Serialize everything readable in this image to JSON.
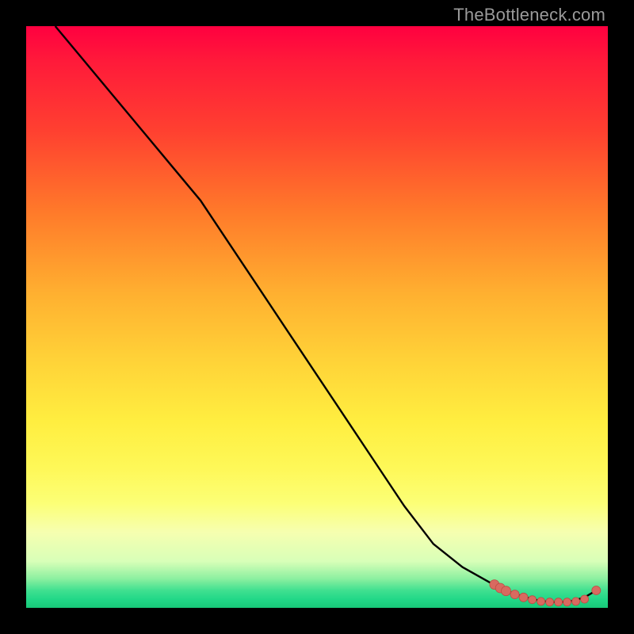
{
  "watermark": "TheBottleneck.com",
  "colors": {
    "page_bg": "#000000",
    "line": "#000000",
    "marker_fill": "#d86a60",
    "marker_stroke": "#c04a42",
    "gradient_top": "#ff0040",
    "gradient_bottom": "#18c878"
  },
  "chart_data": {
    "type": "line",
    "title": "",
    "xlabel": "",
    "ylabel": "",
    "xlim": [
      0,
      100
    ],
    "ylim": [
      0,
      100
    ],
    "grid": false,
    "legend": false,
    "series": [
      {
        "name": "curve",
        "x": [
          5,
          10,
          15,
          20,
          25,
          30,
          35,
          40,
          45,
          50,
          55,
          60,
          65,
          70,
          75,
          80,
          82,
          84,
          86,
          88,
          90,
          92,
          94,
          96,
          98
        ],
        "y": [
          100,
          94,
          88,
          82,
          76,
          70,
          62.5,
          55,
          47.5,
          40,
          32.5,
          25,
          17.5,
          11,
          7,
          4.2,
          3.2,
          2.4,
          1.8,
          1.3,
          1.0,
          1.0,
          1.2,
          1.8,
          3.0
        ]
      }
    ],
    "markers": {
      "name": "bottom-cluster",
      "x": [
        80.5,
        81.5,
        82.5,
        84,
        85.5,
        87,
        88.5,
        90,
        91.5,
        93,
        94.5,
        96,
        98
      ],
      "y": [
        4.0,
        3.4,
        2.9,
        2.3,
        1.8,
        1.4,
        1.1,
        1.0,
        1.0,
        1.0,
        1.1,
        1.5,
        3.0
      ],
      "r": [
        6,
        6,
        6,
        5.5,
        5.5,
        5,
        5,
        5,
        5,
        5,
        5,
        5,
        5.5
      ]
    }
  }
}
